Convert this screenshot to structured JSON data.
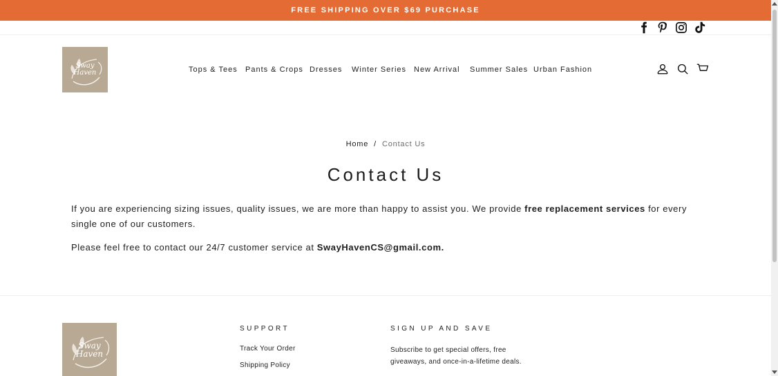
{
  "announcement": {
    "text": "FREE SHIPPING OVER $69 PURCHASE"
  },
  "colors": {
    "announcement_bg": "#e46b33",
    "logo_bg": "#b8a994"
  },
  "social": [
    {
      "name": "facebook-icon"
    },
    {
      "name": "pinterest-icon"
    },
    {
      "name": "instagram-icon"
    },
    {
      "name": "tiktok-icon"
    }
  ],
  "brand": {
    "line1": "Sway",
    "line2": "Haven"
  },
  "nav": {
    "items": [
      {
        "label": "Tops & Tees"
      },
      {
        "label": "Pants & Crops"
      },
      {
        "label": "Dresses"
      },
      {
        "label": "Winter Series"
      },
      {
        "label": "New Arrival"
      },
      {
        "label": "Summer Sales"
      },
      {
        "label": "Urban Fashion"
      }
    ]
  },
  "header_icons": [
    "account-icon",
    "search-icon",
    "cart-icon"
  ],
  "breadcrumb": {
    "home": "Home",
    "separator": "/",
    "current": "Contact Us"
  },
  "page": {
    "title": "Contact Us",
    "para1_part1": "If you are experiencing sizing issues, quality issues, we are more than happy to assist you. We provide ",
    "para1_bold": "free replacement services",
    "para1_part2": " for every single one of our customers.",
    "para2_part1": "Please feel free to contact our 24/7 customer service at ",
    "para2_email": "SwayHavenCS@gmail.com."
  },
  "footer": {
    "support_heading": "SUPPORT",
    "support_links": [
      {
        "label": "Track Your Order"
      },
      {
        "label": "Shipping Policy"
      }
    ],
    "signup_heading": "SIGN UP AND SAVE",
    "signup_text": "Subscribe to get special offers, free giveaways, and once-in-a-lifetime deals."
  }
}
